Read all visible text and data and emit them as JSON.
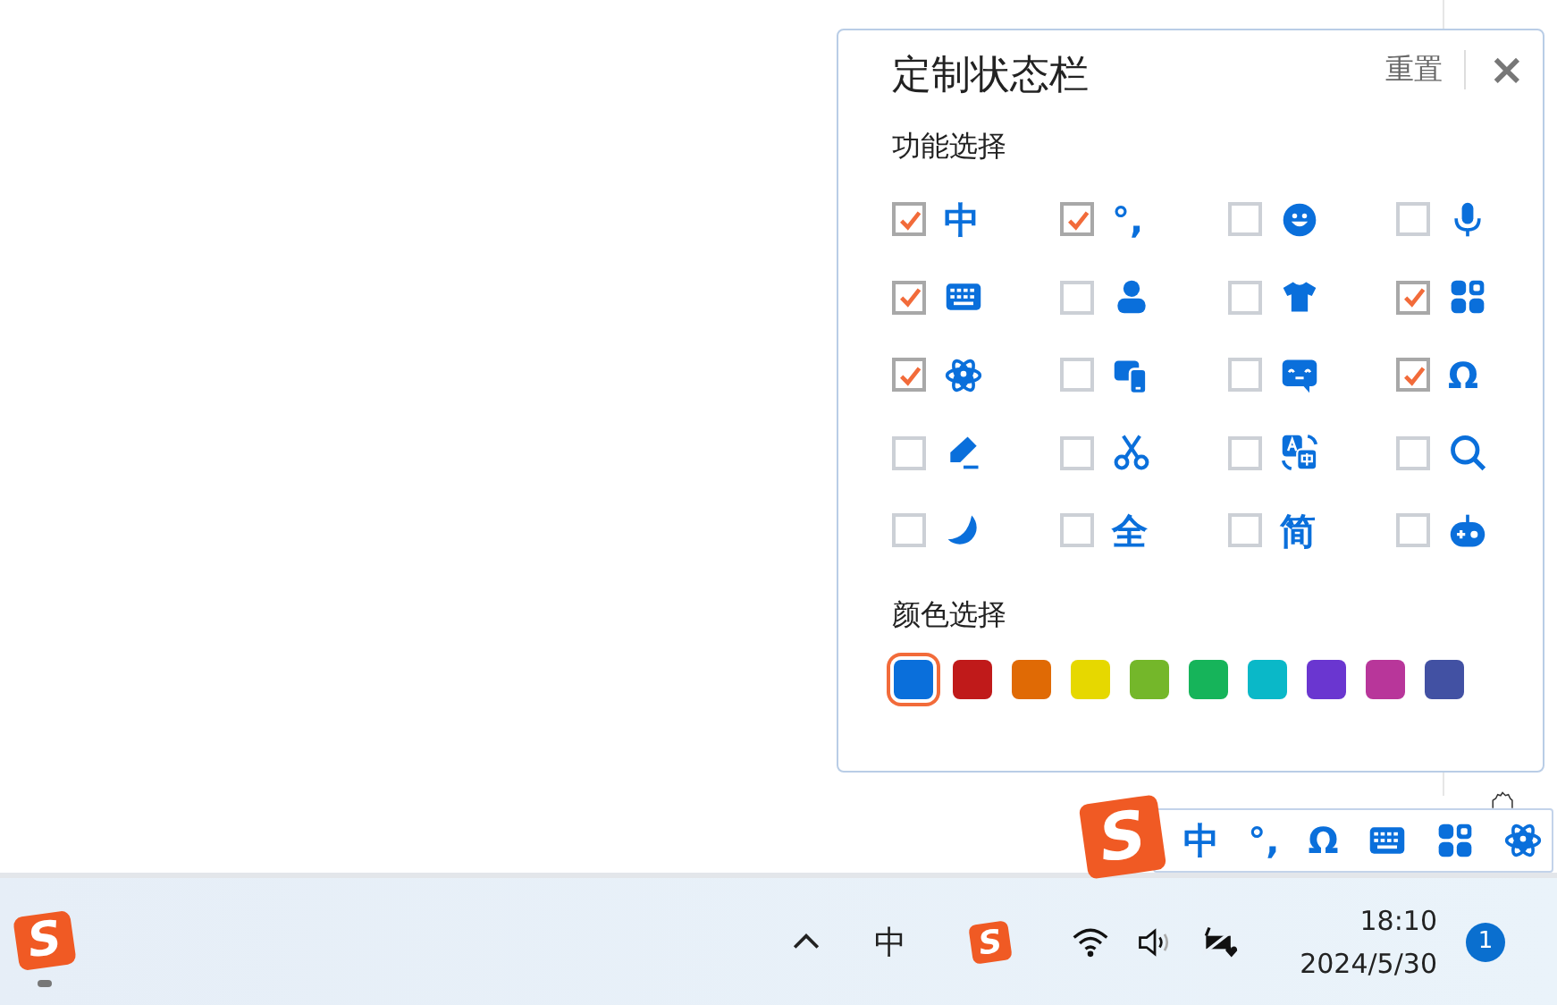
{
  "panel": {
    "title": "定制状态栏",
    "reset_button": "重置",
    "close_button": "×",
    "features_label": "功能选择",
    "features": [
      {
        "kind": "glyph",
        "text": "中",
        "checked": true
      },
      {
        "kind": "glyph",
        "text": "°,",
        "checked": true
      },
      {
        "kind": "icon",
        "checked": false
      },
      {
        "kind": "icon",
        "checked": false
      },
      {
        "kind": "icon",
        "checked": true
      },
      {
        "kind": "icon",
        "checked": false
      },
      {
        "kind": "icon",
        "checked": false
      },
      {
        "kind": "icon",
        "checked": true
      },
      {
        "kind": "icon",
        "checked": true
      },
      {
        "kind": "icon",
        "checked": false
      },
      {
        "kind": "icon",
        "checked": false
      },
      {
        "kind": "glyph",
        "text": "Ω",
        "checked": true
      },
      {
        "kind": "icon",
        "checked": false
      },
      {
        "kind": "icon",
        "checked": false
      },
      {
        "kind": "icon",
        "checked": false
      },
      {
        "kind": "icon",
        "checked": false
      },
      {
        "kind": "icon",
        "checked": false
      },
      {
        "kind": "glyph",
        "text": "全",
        "checked": false
      },
      {
        "kind": "glyph",
        "text": "简",
        "checked": false
      },
      {
        "kind": "icon",
        "checked": false
      }
    ],
    "colors_label": "颜色选择",
    "colors": [
      {
        "color": "#0a6fdb",
        "selected": true
      },
      {
        "color": "#c01a1a",
        "selected": false
      },
      {
        "color": "#e06a05",
        "selected": false
      },
      {
        "color": "#e6d800",
        "selected": false
      },
      {
        "color": "#74b72a",
        "selected": false
      },
      {
        "color": "#16b45a",
        "selected": false
      },
      {
        "color": "#0ab8c8",
        "selected": false
      },
      {
        "color": "#6a36d0",
        "selected": false
      },
      {
        "color": "#b8369a",
        "selected": false
      },
      {
        "color": "#4251a3",
        "selected": false
      }
    ]
  },
  "status_bar": {
    "logo": "S",
    "items": [
      {
        "kind": "glyph",
        "text": "中"
      },
      {
        "kind": "glyph",
        "text": "°,"
      },
      {
        "kind": "glyph",
        "text": "Ω"
      },
      {
        "kind": "icon"
      },
      {
        "kind": "icon"
      },
      {
        "kind": "icon"
      }
    ]
  },
  "taskbar": {
    "app_logo": "S",
    "ime_indicator": "中",
    "tray_logo": "S",
    "time": "18:10",
    "date": "2024/5/30",
    "notification_count": "1"
  }
}
